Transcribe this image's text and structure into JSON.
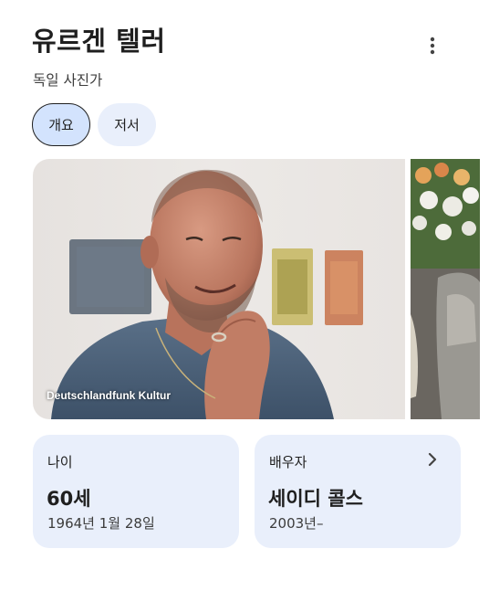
{
  "header": {
    "title": "유르겐 텔러",
    "subtitle": "독일 사진가",
    "menu_icon": "more-vert-icon"
  },
  "tabs": [
    {
      "label": "개요",
      "selected": true
    },
    {
      "label": "저서",
      "selected": false
    }
  ],
  "images": {
    "main_credit": "Deutschlandfunk Kultur"
  },
  "cards": {
    "age": {
      "label": "나이",
      "value": "60세",
      "detail": "1964년 1월 28일"
    },
    "spouse": {
      "label": "배우자",
      "value": "세이디 콜스",
      "detail": "2003년–",
      "icon": "chevron-right-icon"
    }
  },
  "colors": {
    "chip_selected": "#d3e3fd",
    "chip_default": "#e9effb",
    "card_bg": "#e9effb",
    "text_primary": "#1f1f1f"
  }
}
